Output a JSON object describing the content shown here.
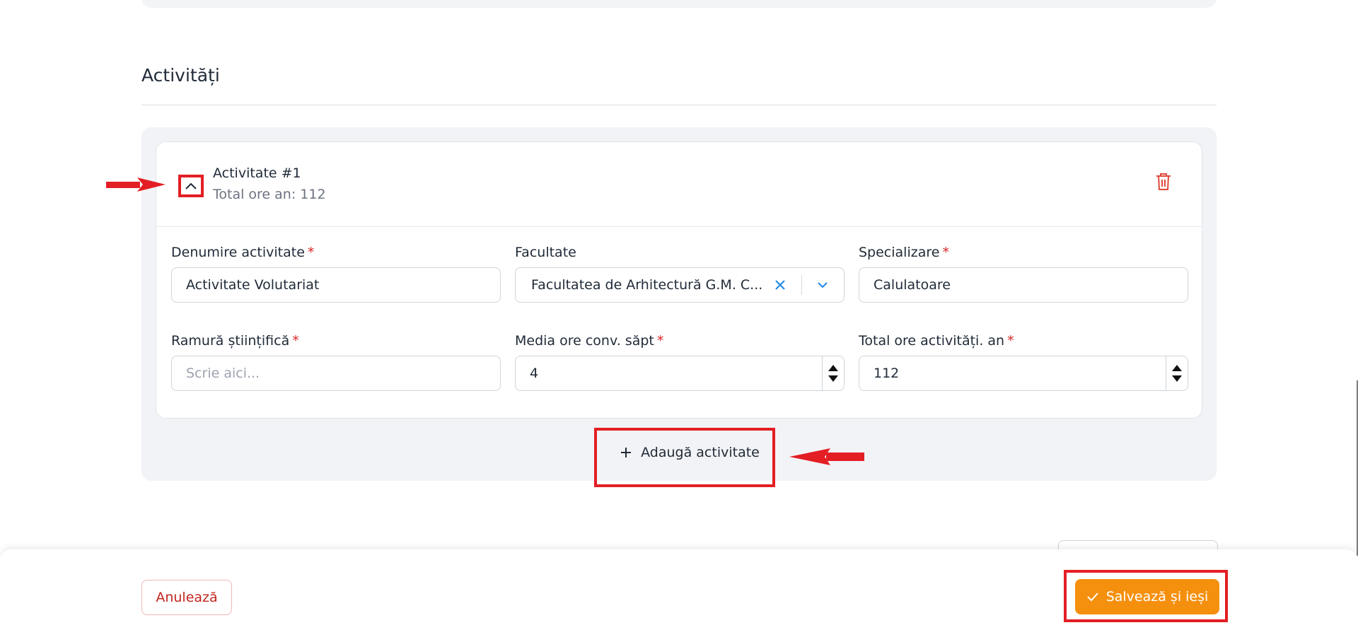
{
  "section": {
    "title": "Activități"
  },
  "activity": {
    "title": "Activitate #1",
    "subtitle": "Total ore an: 112",
    "fields": {
      "denumire": {
        "label": "Denumire activitate",
        "required": "*",
        "value": "Activitate Volutariat"
      },
      "facultate": {
        "label": "Facultate",
        "value": "Facultatea de Arhitectură G.M. C..."
      },
      "specializare": {
        "label": "Specializare",
        "required": "*",
        "value": "Calulatoare"
      },
      "ramura": {
        "label": "Ramură științifică",
        "required": "*",
        "placeholder": "Scrie aici..."
      },
      "media": {
        "label": "Media ore conv. săpt",
        "required": "*",
        "value": "4"
      },
      "total": {
        "label": "Total ore activități. an",
        "required": "*",
        "value": "112"
      }
    }
  },
  "buttons": {
    "add_activity": "Adaugă activitate",
    "cancel": "Anulează",
    "save_exit": "Salvează și ieși"
  },
  "colors": {
    "accent_orange": "#f5900e",
    "danger_red": "#dc2626",
    "annotation_red": "#e31e24",
    "clear_blue": "#1e88e5"
  },
  "icons": {
    "toggle": "chevron-up-icon",
    "delete": "trash-icon",
    "clear": "close-icon",
    "dropdown": "chevron-down-icon",
    "add": "plus-icon",
    "save": "check-icon",
    "annotation": "arrow-icon"
  }
}
